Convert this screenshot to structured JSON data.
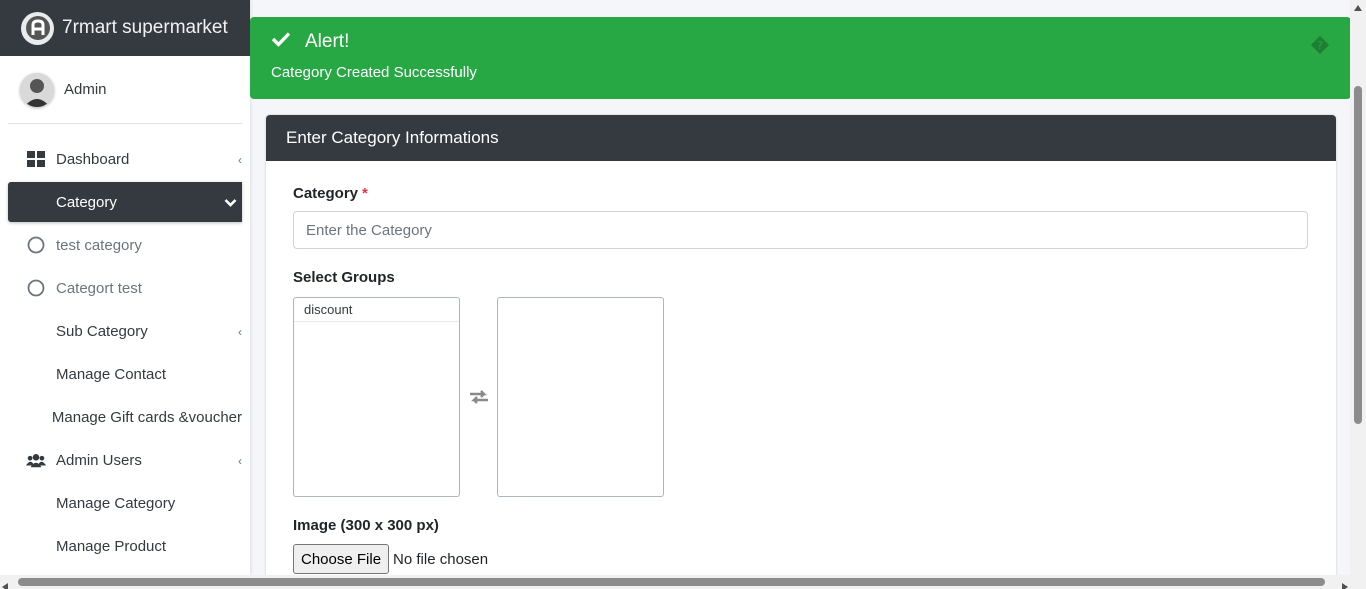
{
  "brand": {
    "title": "7rmart supermarket",
    "icon": "brand-logo-icon"
  },
  "user": {
    "name": "Admin"
  },
  "sidebar": {
    "items": [
      {
        "label": "Dashboard",
        "icon": "dashboard-icon"
      },
      {
        "label": "Category",
        "active": true
      },
      {
        "label": "test category",
        "icon": "circle-icon"
      },
      {
        "label": "Categort test",
        "icon": "circle-icon"
      },
      {
        "label": "Sub Category"
      },
      {
        "label": "Manage Contact"
      },
      {
        "label": "Manage Gift cards &voucher"
      },
      {
        "label": "Admin Users",
        "icon": "users-icon"
      },
      {
        "label": "Manage Category"
      },
      {
        "label": "Manage Product"
      }
    ]
  },
  "alert": {
    "title": "Alert!",
    "message": "Category Created Successfully",
    "color": "#28a745"
  },
  "form": {
    "header": "Enter Category Informations",
    "category_label": "Category",
    "required_mark": "*",
    "category_placeholder": "Enter the Category",
    "groups_label": "Select Groups",
    "available_groups": [
      "discount"
    ],
    "image_label": "Image (300 x 300 px)",
    "file_button": "Choose File",
    "file_status": "No file chosen"
  },
  "colors": {
    "dark": "#343a40",
    "success": "#28a745",
    "danger": "#dc3545"
  }
}
